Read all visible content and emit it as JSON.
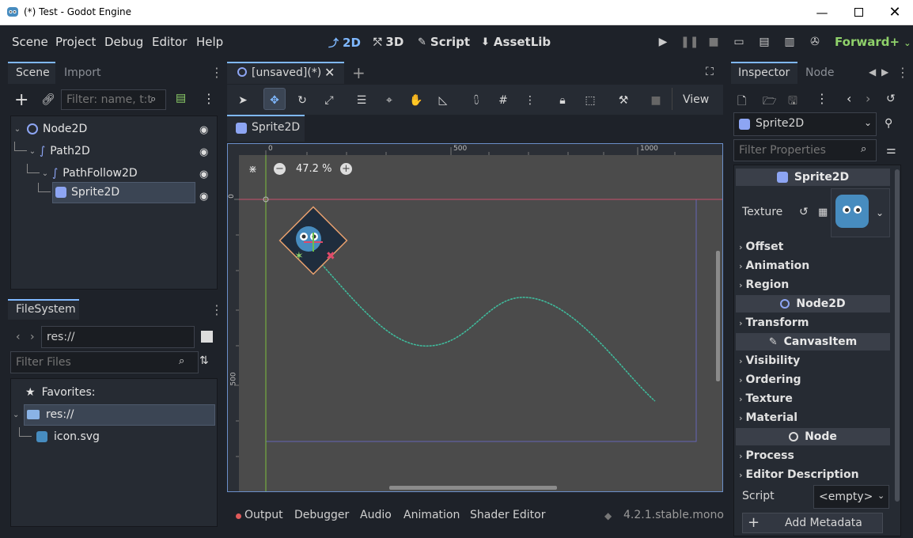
{
  "window": {
    "title": "(*) Test - Godot Engine"
  },
  "menu": {
    "items": [
      "Scene",
      "Project",
      "Debug",
      "Editor",
      "Help"
    ]
  },
  "modes": {
    "m2d": "2D",
    "m3d": "3D",
    "script": "Script",
    "assetlib": "AssetLib"
  },
  "renderer": "Forward+",
  "scene_dock": {
    "tab_scene": "Scene",
    "tab_import": "Import",
    "filter_placeholder": "Filter: name, t:t",
    "nodes": [
      "Node2D",
      "Path2D",
      "PathFollow2D",
      "Sprite2D"
    ]
  },
  "filesystem": {
    "title": "FileSystem",
    "path": "res://",
    "filter_placeholder": "Filter Files",
    "favorites": "Favorites:",
    "res_folder": "res://",
    "file": "icon.svg"
  },
  "editor": {
    "scene_tab": "[unsaved](*)",
    "view_label": "View",
    "node_tab": "Sprite2D",
    "zoom": "47.2 %",
    "ruler_top": [
      "0",
      "500",
      "1000"
    ],
    "ruler_left": [
      "0",
      "500"
    ]
  },
  "inspector": {
    "tab_inspector": "Inspector",
    "tab_node": "Node",
    "node_type": "Sprite2D",
    "filter_placeholder": "Filter Properties",
    "section_sprite": "Sprite2D",
    "texture_label": "Texture",
    "props_sprite": [
      "Offset",
      "Animation",
      "Region"
    ],
    "section_node2d": "Node2D",
    "props_node2d": [
      "Transform"
    ],
    "section_canvas": "CanvasItem",
    "props_canvas": [
      "Visibility",
      "Ordering",
      "Texture",
      "Material"
    ],
    "section_node": "Node",
    "props_node": [
      "Process",
      "Editor Description"
    ],
    "script_label": "Script",
    "script_value": "<empty>",
    "add_metadata": "Add Metadata"
  },
  "bottom": {
    "tabs": [
      "Output",
      "Debugger",
      "Audio",
      "Animation",
      "Shader Editor"
    ],
    "version": "4.2.1.stable.mono"
  },
  "colors": {
    "accent": "#7fb8ff",
    "path": "#3fbf9f",
    "renderer": "#8fd16a"
  }
}
